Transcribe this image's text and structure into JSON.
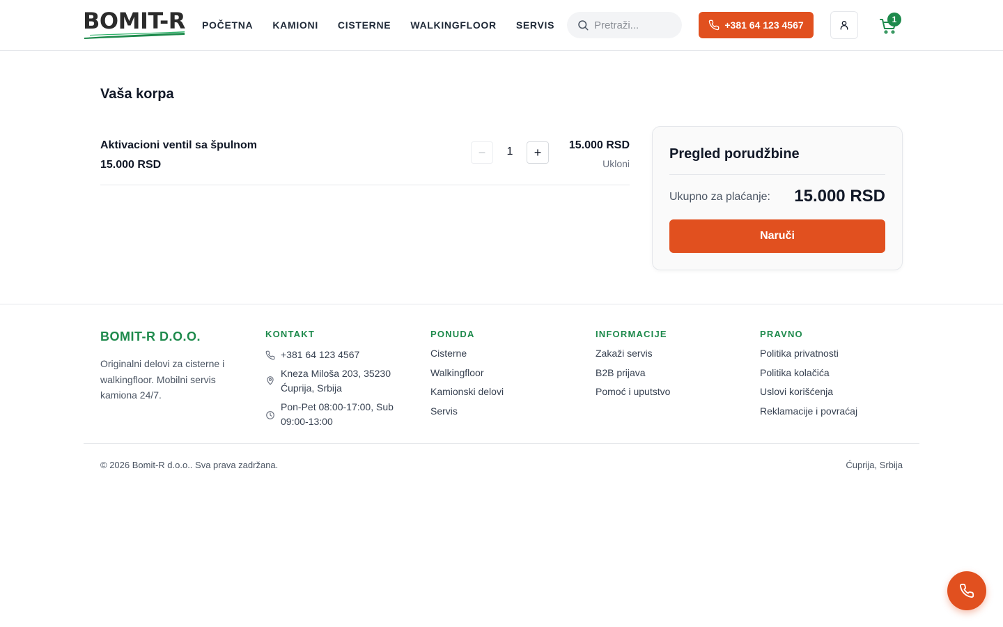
{
  "header": {
    "logo_text": "BOMIT-R",
    "nav": [
      "POČETNA",
      "KAMIONI",
      "CISTERNE",
      "WALKINGFLOOR",
      "SERVIS"
    ],
    "search_placeholder": "Pretraži...",
    "phone_label": "+381 64 123 4567",
    "cart_count": "1",
    "icons": [
      "search-icon",
      "phone-icon",
      "user-icon",
      "cart-icon"
    ]
  },
  "cart": {
    "title": "Vaša korpa",
    "items": [
      {
        "name": "Aktivacioni ventil sa špulnom",
        "unit_price": "15.000 RSD",
        "quantity": "1",
        "minus_label": "−",
        "plus_label": "+",
        "total": "15.000 RSD",
        "remove_label": "Ukloni"
      }
    ]
  },
  "summary": {
    "title": "Pregled porudžbine",
    "total_label": "Ukupno za plaćanje:",
    "total_value": "15.000 RSD",
    "order_button": "Naruči"
  },
  "footer": {
    "brand_title": "BOMIT-R D.O.O.",
    "brand_desc": "Originalni delovi za cisterne i walkingfloor. Mobilni servis kamiona 24/7.",
    "contact": {
      "title": "KONTAKT",
      "phone": "+381 64 123 4567",
      "address": "Kneza Miloša 203, 35230 Ćuprija, Srbija",
      "hours": "Pon-Pet 08:00-17:00, Sub 09:00-13:00"
    },
    "offer": {
      "title": "PONUDA",
      "links": [
        "Cisterne",
        "Walkingfloor",
        "Kamionski delovi",
        "Servis"
      ]
    },
    "info": {
      "title": "INFORMACIJE",
      "links": [
        "Zakaži servis",
        "B2B prijava",
        "Pomoć i uputstvo"
      ]
    },
    "legal": {
      "title": "PRAVNO",
      "links": [
        "Politika privatnosti",
        "Politika kolačića",
        "Uslovi korišćenja",
        "Reklamacije i povraćaj"
      ]
    },
    "copyright": "© 2026 Bomit-R d.o.o.. Sva prava zadržana.",
    "location": "Ćuprija, Srbija"
  },
  "colors": {
    "accent": "#e1501f",
    "brand_green": "#1e8a4c",
    "text": "#111827"
  }
}
